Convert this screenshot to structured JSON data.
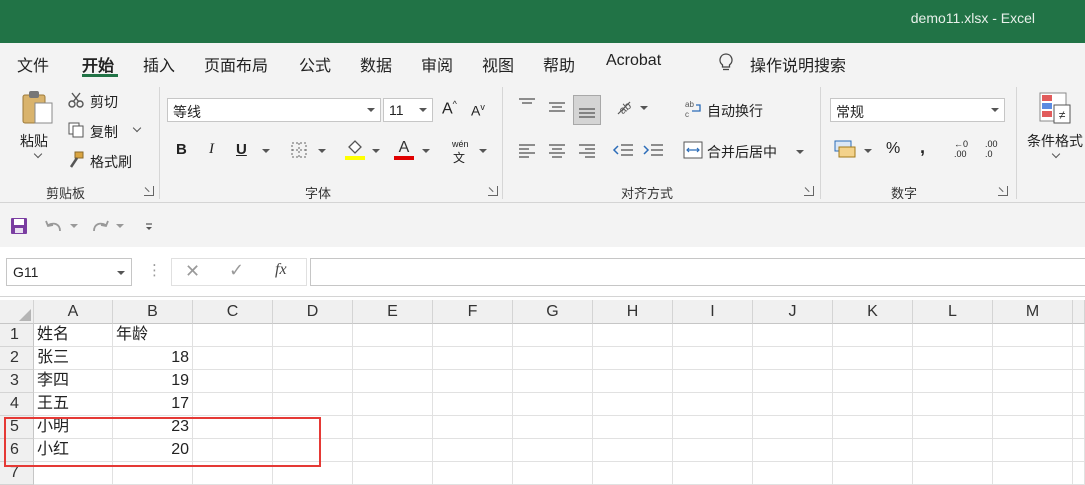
{
  "window": {
    "title": "demo11.xlsx  -  Excel"
  },
  "menu": {
    "tabs": [
      "文件",
      "开始",
      "插入",
      "页面布局",
      "公式",
      "数据",
      "审阅",
      "视图",
      "帮助",
      "Acrobat"
    ],
    "active_tab": "开始",
    "search_label": "操作说明搜索"
  },
  "ribbon": {
    "clipboard": {
      "group_label": "剪贴板",
      "paste": "粘贴",
      "cut": "剪切",
      "copy": "复制",
      "format_painter": "格式刷"
    },
    "font": {
      "group_label": "字体",
      "font_name": "等线",
      "font_size": "11",
      "bold": "B",
      "italic": "I",
      "underline": "U",
      "phonetic": "wén"
    },
    "alignment": {
      "group_label": "对齐方式",
      "wrap_text": "自动换行",
      "merge_center": "合并后居中"
    },
    "number": {
      "group_label": "数字",
      "format": "常规",
      "percent": "%",
      "comma": ",",
      "inc_decimal": ".00",
      "dec_decimal": ".0"
    },
    "styles": {
      "conditional_format": "条件格式"
    }
  },
  "formula_bar": {
    "name_box": "G11",
    "fx": "fx",
    "formula": ""
  },
  "sheet": {
    "columns": [
      "A",
      "B",
      "C",
      "D",
      "E",
      "F",
      "G",
      "H",
      "I",
      "J",
      "K",
      "L",
      "M"
    ],
    "rows": [
      {
        "n": "1",
        "a": "姓名",
        "b": "年龄"
      },
      {
        "n": "2",
        "a": "张三",
        "b": "18"
      },
      {
        "n": "3",
        "a": "李四",
        "b": "19"
      },
      {
        "n": "4",
        "a": "王五",
        "b": "17"
      },
      {
        "n": "5",
        "a": "小明",
        "b": "23"
      },
      {
        "n": "6",
        "a": "小红",
        "b": "20"
      },
      {
        "n": "7",
        "a": "",
        "b": ""
      }
    ]
  },
  "colors": {
    "excel_green": "#217346",
    "highlight_red": "#e53935"
  }
}
